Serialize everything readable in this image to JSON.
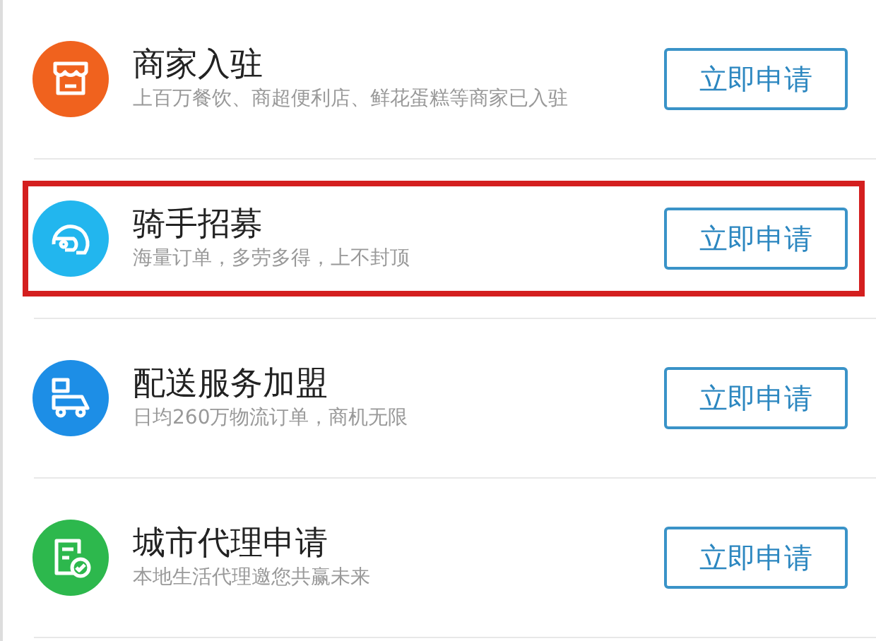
{
  "items": [
    {
      "kind": "shop",
      "color": "#f0621e",
      "title": "商家入驻",
      "subtitle": "上百万餐饮、商超便利店、鲜花蛋糕等商家已入驻",
      "button": "立即申请",
      "highlighted": false
    },
    {
      "kind": "helmet",
      "color": "#22b6ee",
      "title": "骑手招募",
      "subtitle": "海量订单，多劳多得，上不封顶",
      "button": "立即申请",
      "highlighted": true
    },
    {
      "kind": "cart",
      "color": "#1d8ee6",
      "title": "配送服务加盟",
      "subtitle": "日均260万物流订单，商机无限",
      "button": "立即申请",
      "highlighted": false
    },
    {
      "kind": "document",
      "color": "#2db84d",
      "title": "城市代理申请",
      "subtitle": "本地生活代理邀您共赢未来",
      "button": "立即申请",
      "highlighted": false
    }
  ]
}
